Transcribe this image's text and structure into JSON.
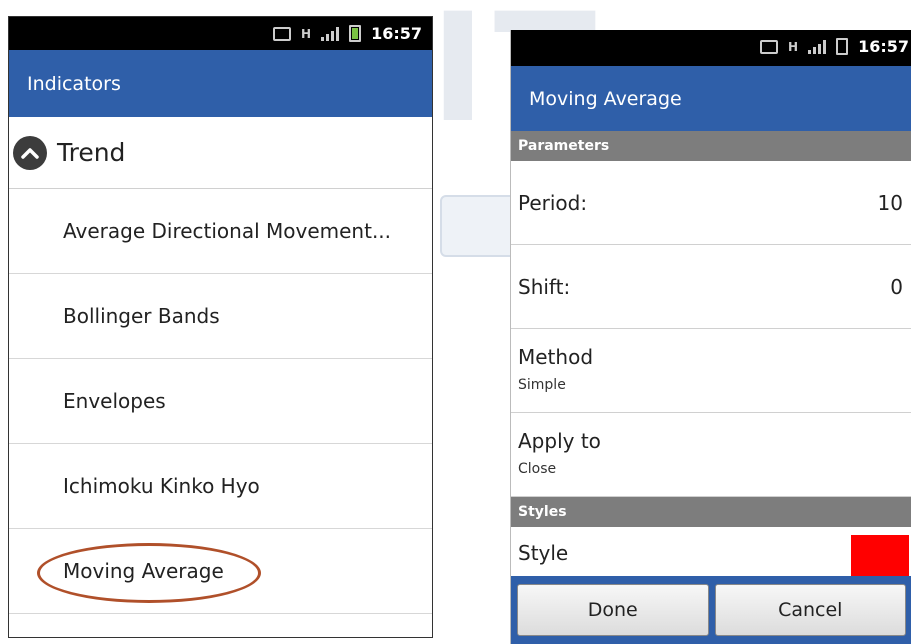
{
  "status": {
    "time": "16:57",
    "network": "H"
  },
  "indicators_screen": {
    "title": "Indicators",
    "group": {
      "label": "Trend"
    },
    "items": [
      {
        "label": "Average Directional Movement..."
      },
      {
        "label": "Bollinger Bands"
      },
      {
        "label": "Envelopes"
      },
      {
        "label": "Ichimoku Kinko Hyo"
      },
      {
        "label": "Moving Average"
      }
    ]
  },
  "moving_average_screen": {
    "title": "Moving Average",
    "parameters_header": "Parameters",
    "period": {
      "label": "Period:",
      "value": "10"
    },
    "shift": {
      "label": "Shift:",
      "value": "0"
    },
    "method": {
      "label": "Method",
      "value": "Simple"
    },
    "apply_to": {
      "label": "Apply to",
      "value": "Close"
    },
    "styles_header": "Styles",
    "style": {
      "label": "Style",
      "color": "#ff0000"
    },
    "buttons": {
      "done": "Done",
      "cancel": "Cancel"
    }
  },
  "colors": {
    "action_bar": "#2f5fa9",
    "section_header": "#7d7d7d",
    "highlight_circle": "#b0502a"
  }
}
